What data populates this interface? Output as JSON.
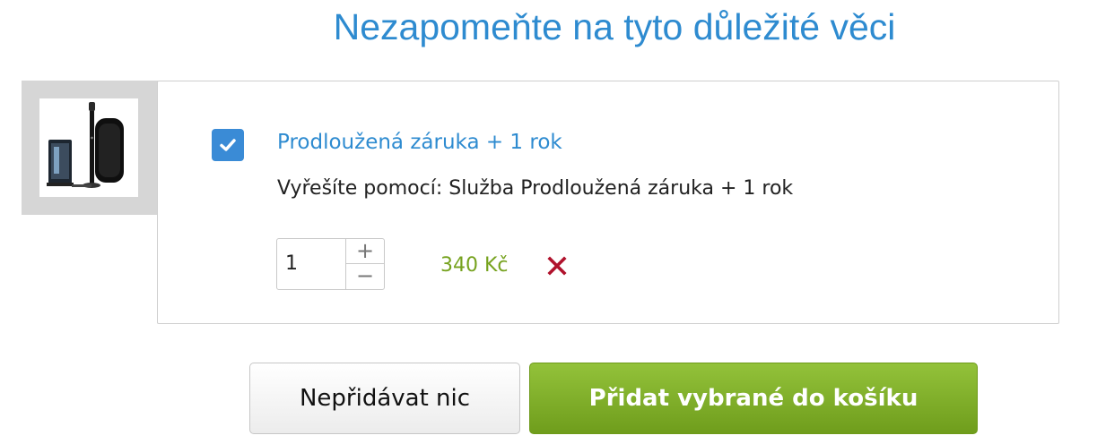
{
  "heading": "Nezapomeňte na tyto důležité věci",
  "product": {
    "image_icon": "electric-toothbrush-with-case"
  },
  "offer": {
    "checked": true,
    "title": "Prodloužená záruka + 1 rok",
    "description": "Vyřešíte pomocí: Služba Prodloužená záruka + 1 rok",
    "quantity": "1",
    "increment_label": "+",
    "decrement_label": "−",
    "price": "340 Kč"
  },
  "actions": {
    "skip_label": "Nepřidávat nic",
    "add_label": "Přidat vybrané do košíku"
  },
  "colors": {
    "accent_blue": "#2e8bd0",
    "checkbox_blue": "#3a8bd6",
    "price_green": "#76a21e",
    "remove_red": "#b0122c",
    "add_button_green": "#7fae28"
  }
}
